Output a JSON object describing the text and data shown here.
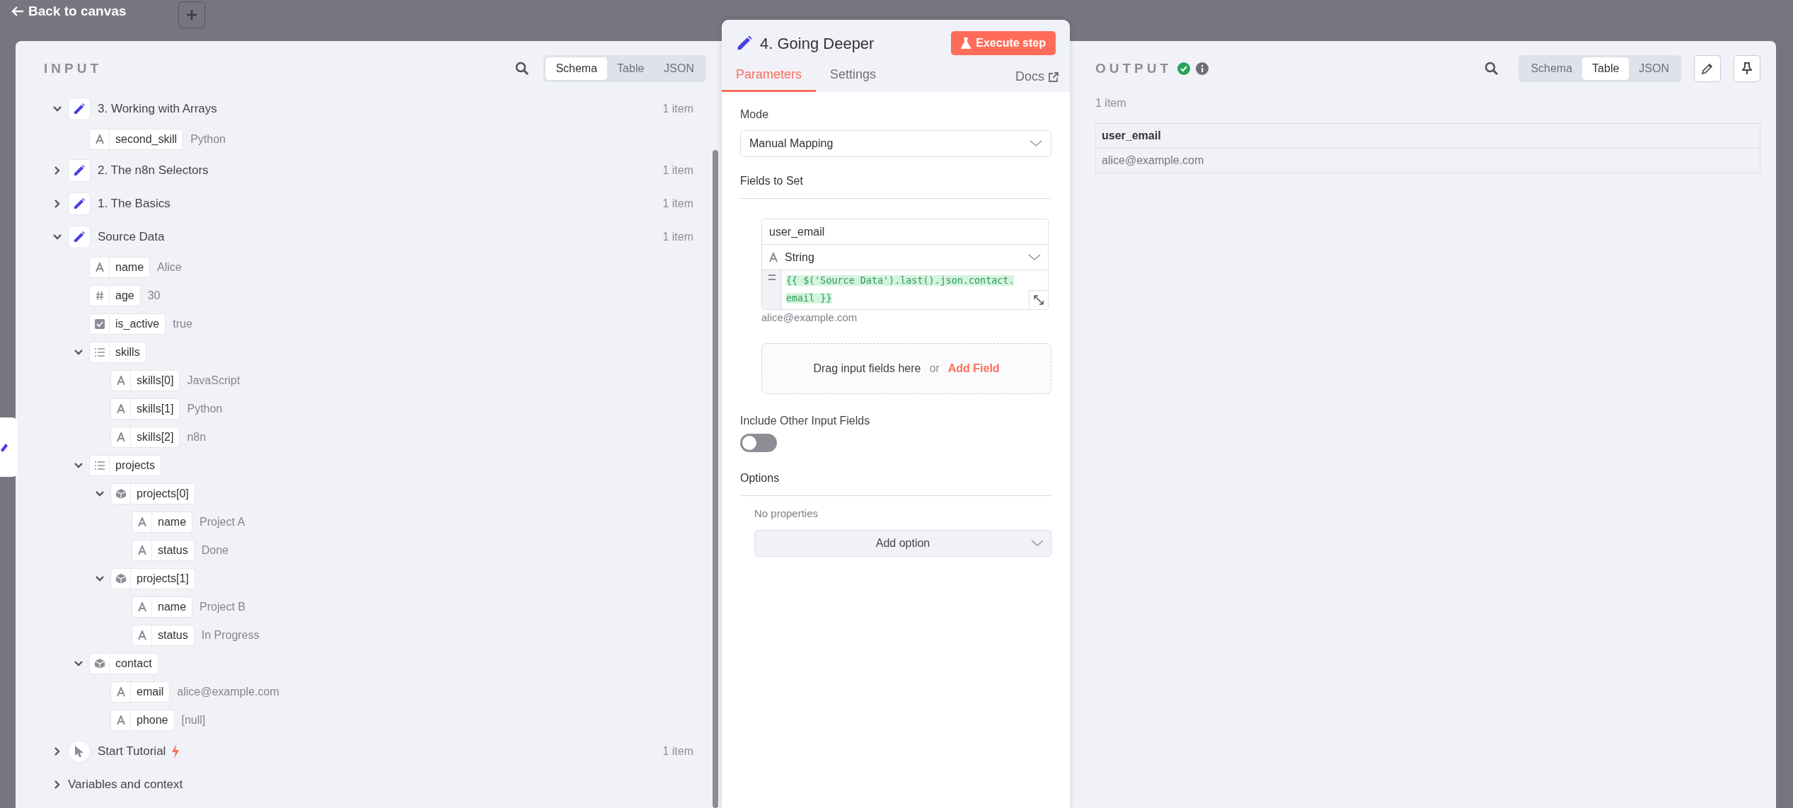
{
  "topbar": {
    "back_label": "Back to canvas"
  },
  "input": {
    "title": "INPUT",
    "views": [
      {
        "label": "Schema",
        "selected": true
      },
      {
        "label": "Table",
        "selected": false
      },
      {
        "label": "JSON",
        "selected": false
      }
    ],
    "tree": [
      {
        "kind": "set",
        "label": "3. Working with Arrays",
        "count": "1 item",
        "expanded": true,
        "children": [
          {
            "kind": "string",
            "key": "second_skill",
            "value": "Python"
          }
        ]
      },
      {
        "kind": "set",
        "label": "2. The n8n Selectors",
        "count": "1 item",
        "expanded": false
      },
      {
        "kind": "set",
        "label": "1. The Basics",
        "count": "1 item",
        "expanded": false
      },
      {
        "kind": "set",
        "label": "Source Data",
        "count": "1 item",
        "expanded": true,
        "children": [
          {
            "kind": "string",
            "key": "name",
            "value": "Alice"
          },
          {
            "kind": "number",
            "key": "age",
            "value": "30"
          },
          {
            "kind": "boolean",
            "key": "is_active",
            "value": "true"
          },
          {
            "kind": "array",
            "key": "skills",
            "expanded": true,
            "children": [
              {
                "kind": "string",
                "key": "skills[0]",
                "value": "JavaScript"
              },
              {
                "kind": "string",
                "key": "skills[1]",
                "value": "Python"
              },
              {
                "kind": "string",
                "key": "skills[2]",
                "value": "n8n"
              }
            ]
          },
          {
            "kind": "array",
            "key": "projects",
            "expanded": true,
            "children": [
              {
                "kind": "object",
                "key": "projects[0]",
                "expanded": true,
                "children": [
                  {
                    "kind": "string",
                    "key": "name",
                    "value": "Project A"
                  },
                  {
                    "kind": "string",
                    "key": "status",
                    "value": "Done"
                  }
                ]
              },
              {
                "kind": "object",
                "key": "projects[1]",
                "expanded": true,
                "children": [
                  {
                    "kind": "string",
                    "key": "name",
                    "value": "Project B"
                  },
                  {
                    "kind": "string",
                    "key": "status",
                    "value": "In Progress"
                  }
                ]
              }
            ]
          },
          {
            "kind": "object",
            "key": "contact",
            "expanded": true,
            "children": [
              {
                "kind": "string",
                "key": "email",
                "value": "alice@example.com"
              },
              {
                "kind": "string",
                "key": "phone",
                "value": "[null]"
              }
            ]
          }
        ]
      },
      {
        "kind": "trigger",
        "label": "Start Tutorial",
        "count": "1 item",
        "expanded": false
      }
    ],
    "footer": {
      "label": "Variables and context",
      "expanded": false
    }
  },
  "node": {
    "title": "4. Going Deeper",
    "execute_label": "Execute step",
    "tabs": [
      {
        "label": "Parameters",
        "selected": true
      },
      {
        "label": "Settings",
        "selected": false
      }
    ],
    "docs_label": "Docs",
    "mode_label": "Mode",
    "mode_value": "Manual Mapping",
    "fields_label": "Fields to Set",
    "fields": [
      {
        "name": "user_email",
        "type": "String",
        "expression": "{{ $('Source Data').last().json.contact.email }}",
        "result": "alice@example.com"
      }
    ],
    "drop_hint": "Drag input fields here",
    "drop_or": "or",
    "add_field": "Add Field",
    "include_label": "Include Other Input Fields",
    "include_on": false,
    "options_label": "Options",
    "no_properties": "No properties",
    "add_option": "Add option"
  },
  "output": {
    "title": "OUTPUT",
    "succeeded": true,
    "views": [
      {
        "label": "Schema",
        "selected": false
      },
      {
        "label": "Table",
        "selected": true
      },
      {
        "label": "JSON",
        "selected": false
      }
    ],
    "count": "1 item",
    "table": {
      "columns": [
        "user_email"
      ],
      "rows": [
        [
          "alice@example.com"
        ]
      ]
    }
  }
}
